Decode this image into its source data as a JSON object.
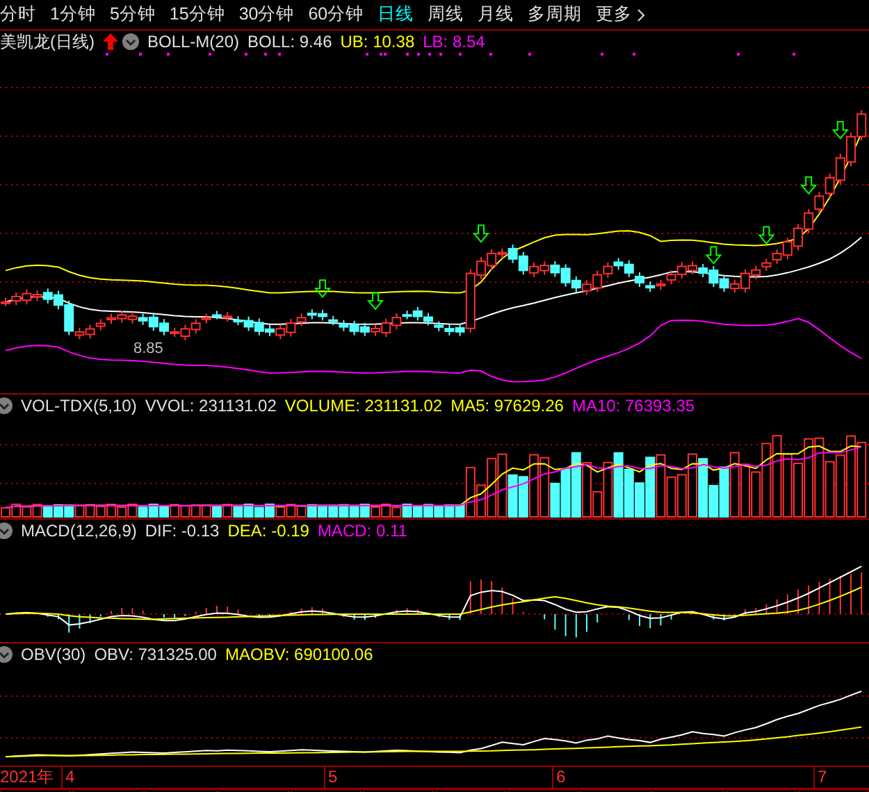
{
  "period_tabs": [
    {
      "label": "分时",
      "selected": false
    },
    {
      "label": "1分钟",
      "selected": false
    },
    {
      "label": "5分钟",
      "selected": false
    },
    {
      "label": "15分钟",
      "selected": false
    },
    {
      "label": "30分钟",
      "selected": false
    },
    {
      "label": "60分钟",
      "selected": false
    },
    {
      "label": "日线",
      "selected": true
    },
    {
      "label": "周线",
      "selected": false
    },
    {
      "label": "月线",
      "selected": false
    },
    {
      "label": "多周期",
      "selected": false
    },
    {
      "label": "更多",
      "selected": false
    }
  ],
  "main_panel": {
    "title": "美凯龙(日线)",
    "indicator": "BOLL-M(20)",
    "readings": [
      {
        "text": "BOLL: 9.46",
        "color": "#e0e0e0"
      },
      {
        "text": "UB: 10.38",
        "color": "#ffff00"
      },
      {
        "text": "LB: 8.54",
        "color": "#ff00ff"
      }
    ],
    "low_label": "8.85"
  },
  "volume_panel": {
    "indicator": "VOL-TDX(5,10)",
    "readings": [
      {
        "text": "VVOL: 231131.02",
        "color": "#e0e0e0"
      },
      {
        "text": "VOLUME: 231131.02",
        "color": "#ffff00"
      },
      {
        "text": "MA5: 97629.26",
        "color": "#ffff00"
      },
      {
        "text": "MA10: 76393.35",
        "color": "#ff00ff"
      }
    ]
  },
  "macd_panel": {
    "indicator": "MACD(12,26,9)",
    "readings": [
      {
        "text": "DIF: -0.13",
        "color": "#e0e0e0"
      },
      {
        "text": "DEA: -0.19",
        "color": "#ffff00"
      },
      {
        "text": "MACD: 0.11",
        "color": "#ff00ff"
      }
    ]
  },
  "obv_panel": {
    "indicator": "OBV(30)",
    "readings": [
      {
        "text": "OBV: 731325.00",
        "color": "#e0e0e0"
      },
      {
        "text": "MAOBV: 690100.06",
        "color": "#ffff00"
      }
    ]
  },
  "date_axis": [
    "2021年",
    "4",
    "5",
    "6",
    "7"
  ]
}
